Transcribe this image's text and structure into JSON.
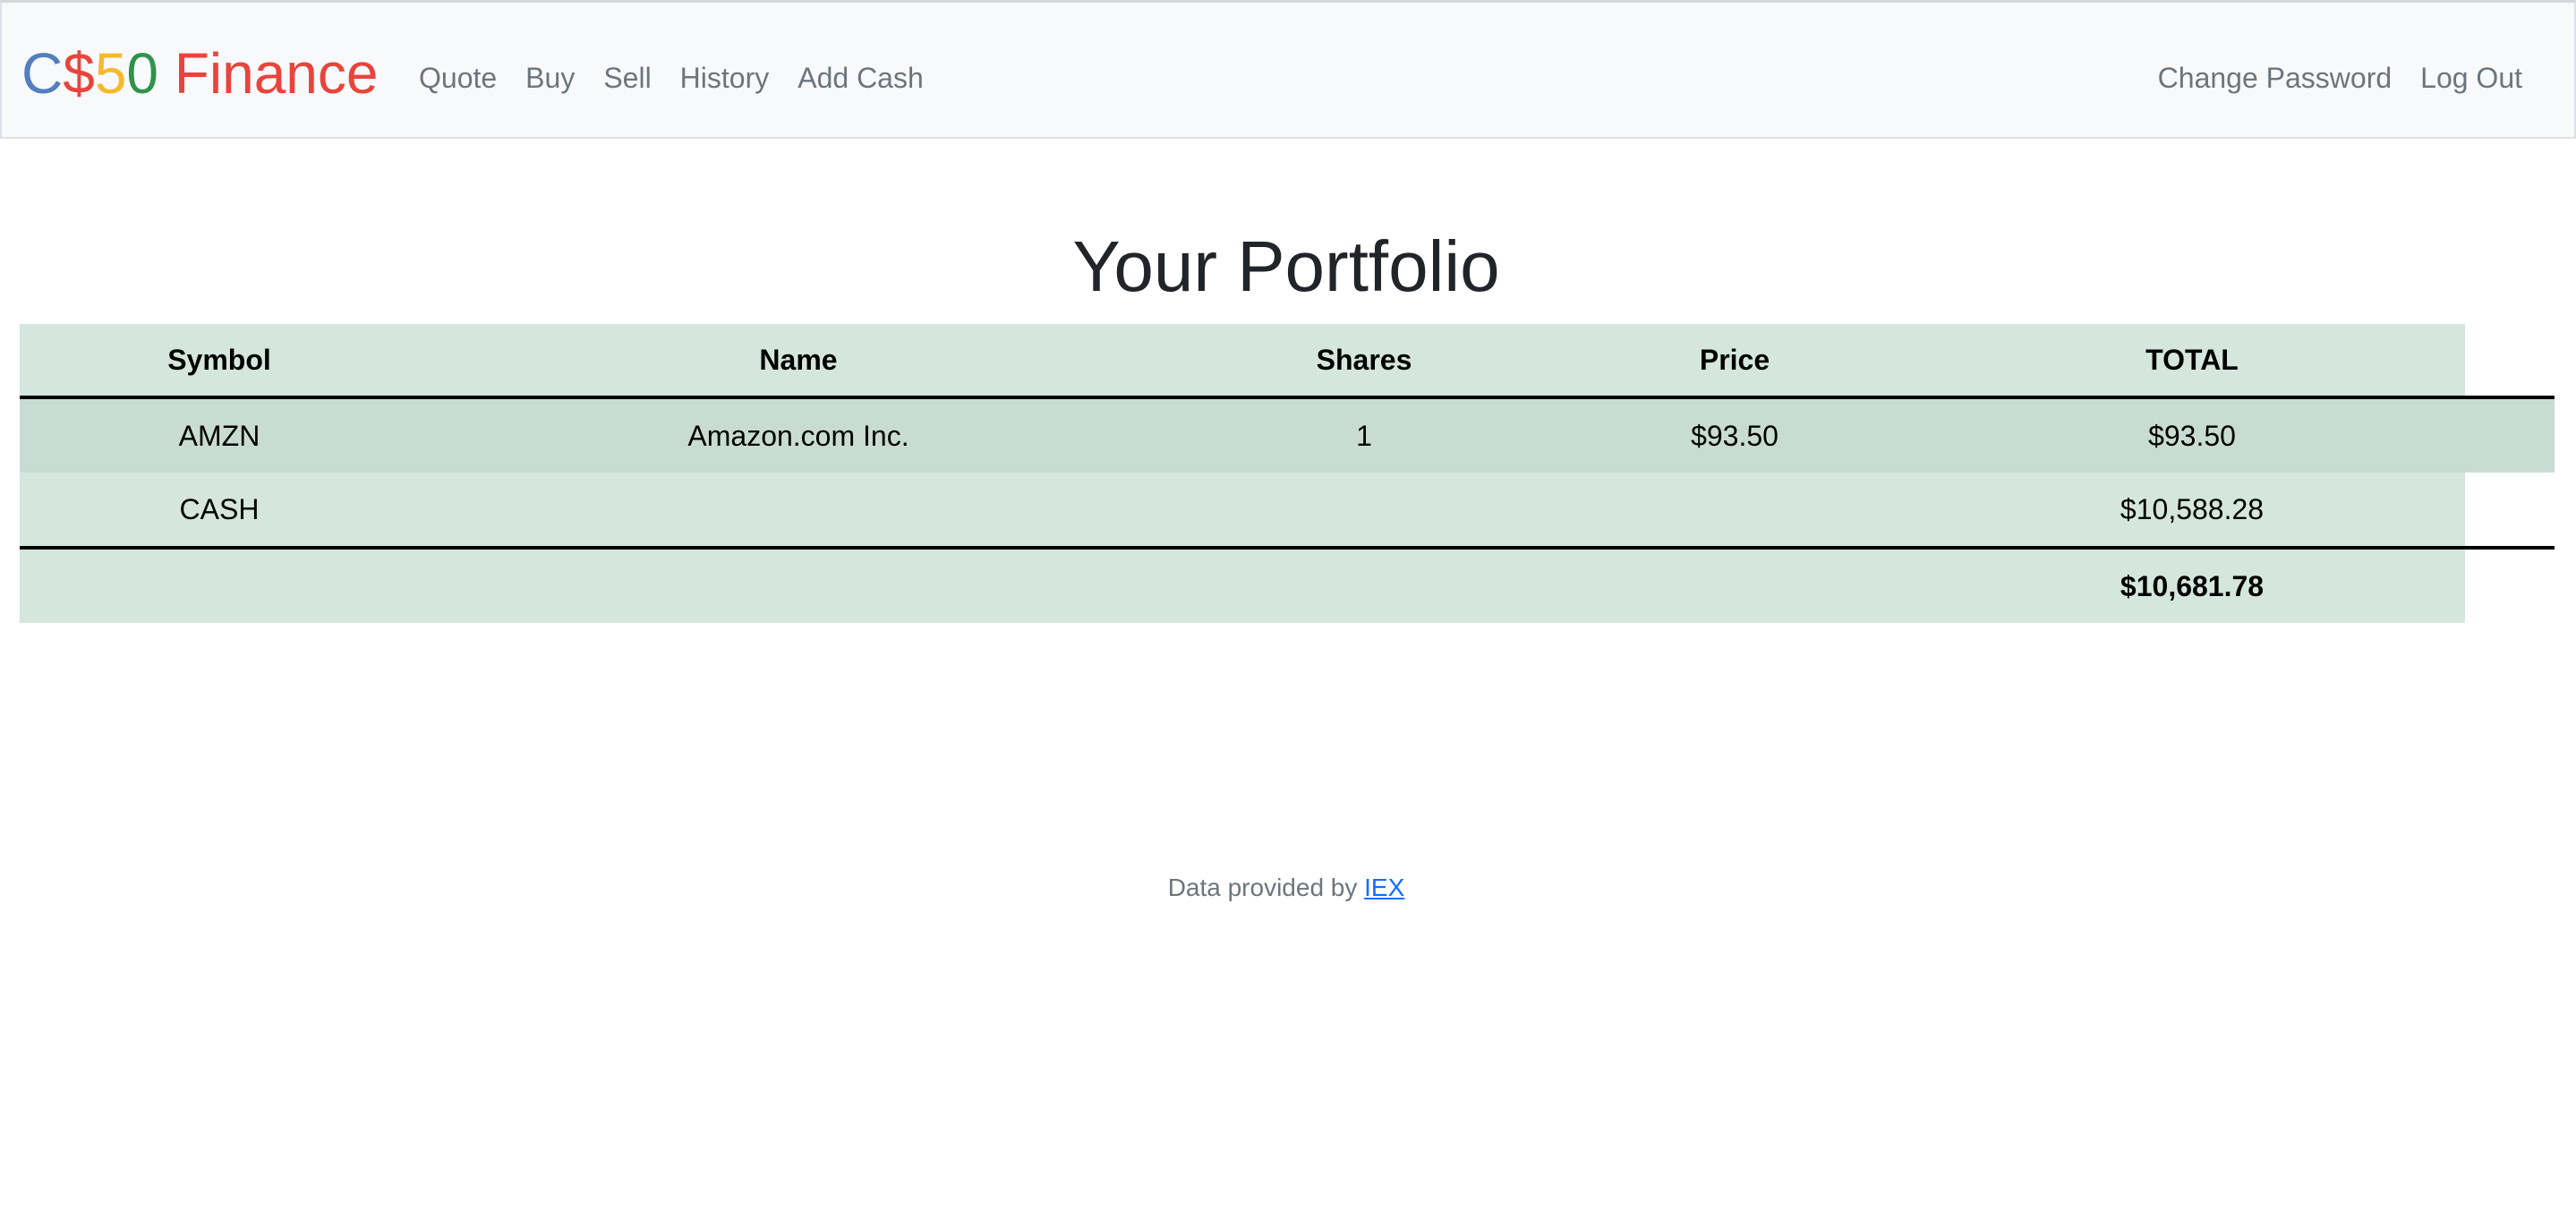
{
  "brand": {
    "parts": [
      "C",
      "$",
      "5",
      "0",
      " Finance"
    ],
    "colors": [
      "#537fbe",
      "#ea433b",
      "#f5b82e",
      "#2e944b",
      "#ea433b"
    ]
  },
  "nav": {
    "left": [
      "Quote",
      "Buy",
      "Sell",
      "History",
      "Add Cash"
    ],
    "right": [
      "Change Password",
      "Log Out"
    ]
  },
  "page": {
    "title": "Your Portfolio"
  },
  "table": {
    "headers": [
      "Symbol",
      "Name",
      "Shares",
      "Price",
      "TOTAL"
    ],
    "rows": [
      {
        "symbol": "AMZN",
        "name": "Amazon.com Inc.",
        "shares": "1",
        "price": "$93.50",
        "total": "$93.50"
      }
    ],
    "cash": {
      "label": "CASH",
      "total": "$10,588.28"
    },
    "grand_total": "$10,681.78"
  },
  "footer": {
    "text": "Data provided by ",
    "link_label": "IEX"
  },
  "colors": {
    "navbar_bg": "#f8f9fa",
    "table_bg": "#d4e6dd",
    "row_highlight": "#c9dcd3",
    "link": "#0d6efd",
    "nav_text": "#6c757d"
  }
}
